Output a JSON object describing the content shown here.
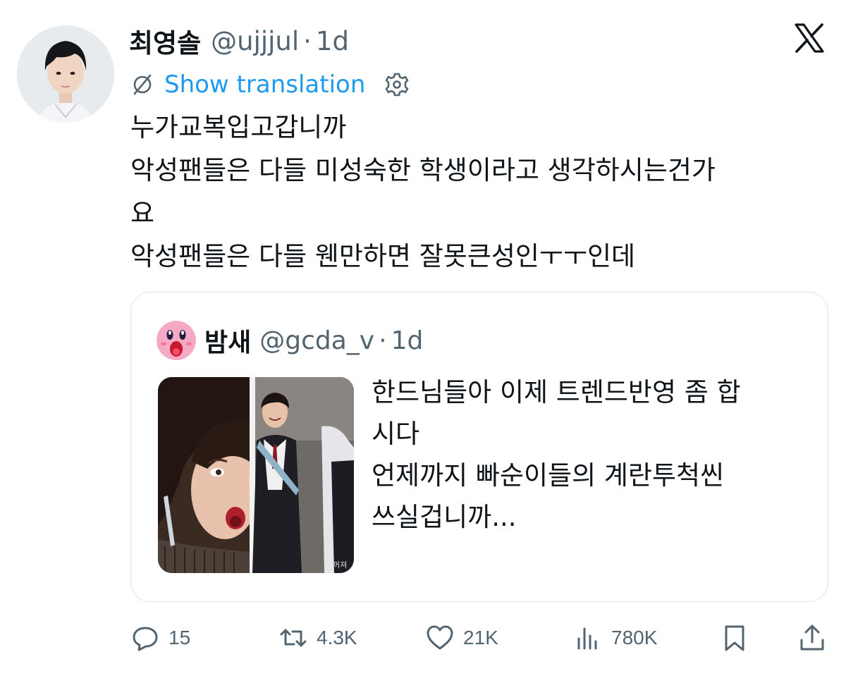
{
  "tweet": {
    "author": {
      "display_name": "최영솔",
      "handle": "@ujjjul",
      "time": "1d"
    },
    "translation_label": "Show translation",
    "text_lines": [
      "누가교복입고갑니까",
      "악성팬들은 다들 미성숙한 학생이라고 생각하시는건가",
      "요",
      "악성팬들은 다들 웬만하면 잘못큰성인ㅜㅜ인데"
    ],
    "quote": {
      "display_name": "밤새",
      "handle": "@gcda_v",
      "time": "1d",
      "text_lines": [
        "한드님들아 이제 트렌드반영 좀 합",
        "시다",
        "언제까지 빠순이들의 계란투척씬",
        "쓰실겁니까..."
      ],
      "media_caption": "꺼져"
    },
    "actions": {
      "replies": "15",
      "retweets": "4.3K",
      "likes": "21K",
      "views": "780K"
    },
    "separator": "·"
  },
  "icons": {
    "logo": "x-logo-icon",
    "translate": "translate-globe-icon",
    "settings": "gear-icon",
    "reply": "reply-icon",
    "retweet": "retweet-icon",
    "like": "heart-icon",
    "views": "views-icon",
    "bookmark": "bookmark-icon",
    "share": "share-icon"
  },
  "colors": {
    "link": "#1d9bf0",
    "secondary_text": "#536471",
    "primary_text": "#0f1419",
    "border": "#dfe4e8"
  }
}
